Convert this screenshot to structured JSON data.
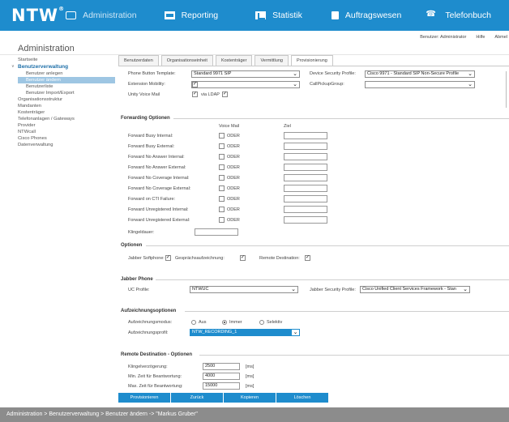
{
  "app": {
    "logo": "NTW",
    "logo_mark": "®"
  },
  "nav": [
    {
      "label": "Administration",
      "icon": "admin-icon"
    },
    {
      "label": "Reporting",
      "icon": "report-icon"
    },
    {
      "label": "Statistik",
      "icon": "statistics-icon"
    },
    {
      "label": "Auftragswesen",
      "icon": "document-icon"
    },
    {
      "label": "Telefonbuch",
      "icon": "phone-icon"
    }
  ],
  "header": {
    "title": "Administration",
    "user": "Benutzer: Administrator",
    "help": "Hilfe",
    "logout": "Abmel"
  },
  "sidebar": {
    "startseite": "Startseite",
    "benutzerverwaltung": "Benutzerverwaltung",
    "benutzer_anlegen": "Benutzer anlegen",
    "benutzer_aendern": "Benutzer ändern",
    "benutzerliste": "Benutzerliste",
    "benutzer_import": "Benutzer Import/Export",
    "organisationsstruktur": "Organisationsstruktur",
    "mandanten": "Mandanten",
    "kostentraeger": "Kostenträger",
    "telefonanlagen": "Telefonanlagen / Gateways",
    "provider": "Provider",
    "ntwcall": "NTWcall",
    "cisco_phones": "Cisco Phones",
    "datenverwaltung": "Datenverwaltung"
  },
  "tabs": {
    "benutzerdaten": "Benutzerdaten",
    "organisationseinheit": "Organisationseinheit",
    "kostentraeger": "Kostenträger",
    "vermittlung": "Vermittlung",
    "provisionierung": "Provisionierung"
  },
  "device": {
    "phone_button_template_label": "Phone Button Template:",
    "phone_button_template_value": "Standard 9971 SIP",
    "device_security_profile_label": "Device Security Profile:",
    "device_security_profile_value": "Cisco 9971 - Standard SIP Non-Secure Profile",
    "extension_mobility_label": "Extension Mobility:",
    "callpickup_group_label": "CallPickupGroup:",
    "unity_voice_mail_label": "Unity Voice Mail",
    "via_ldap_label": "via LDAP"
  },
  "forwarding": {
    "title": "Forwarding Optionen",
    "voice_mail_header": "Voice Mail",
    "ziel_header": "Ziel",
    "oder": "ODER",
    "rows": {
      "busy_internal": "Forward Busy Internal:",
      "busy_external": "Forward Busy External:",
      "no_answer_internal": "Forward No Answer Internal:",
      "no_answer_external": "Forward No Answer External:",
      "no_coverage_internal": "Forward No Coverage Internal:",
      "no_coverage_external": "Forward No Coverage External:",
      "cti_failure": "Forward on CTI Failure:",
      "unregistered_internal": "Forward Unregistered Internal:",
      "unregistered_external": "Forward Unregistered External:"
    },
    "klingeldauer_label": "Klingeldauer:"
  },
  "optionen": {
    "title": "Optionen",
    "jabber_softphone_label": "Jabber Softphone:",
    "gespraechsaufzeichnung_label": "Gesprächsaufzeichnung:",
    "remote_destination_label": "Remote Destination:"
  },
  "jabber": {
    "title": "Jabber Phone",
    "uc_profile_label": "UC Profile:",
    "uc_profile_value": "NTWUC",
    "security_profile_label": "Jabber Security Profile:",
    "security_profile_value": "Cisco Unified Client Services Framework - Stan"
  },
  "aufzeichnung": {
    "title": "Aufzeichnungsoptionen",
    "modus_label": "Aufzeichnungsmodus:",
    "aus": "Aus",
    "immer": "Immer",
    "selektiv": "Selektiv",
    "profil_label": "Aufzeichnungsprofil:",
    "profil_value": "NTW_RECORDING_1"
  },
  "remote": {
    "title": "Remote Destination - Optionen",
    "klingelverzoegerung_label": "Klingelverzögerung:",
    "klingelverzoegerung_value": "2500",
    "min_zeit_label": "Min. Zeit für Beantwortung:",
    "min_zeit_value": "4000",
    "max_zeit_label": "Max. Zeit für Beantwortung:",
    "max_zeit_value": "15000",
    "unit": "[ms]"
  },
  "buttons": {
    "provisionieren": "Provisionieren",
    "zurueck": "Zurück",
    "kopieren": "Kopieren",
    "loeschen": "Löschen"
  },
  "statusbar": "Administration  >  Benutzerverwaltung  >  Benutzer ändern -> \"Markus Gruber\""
}
